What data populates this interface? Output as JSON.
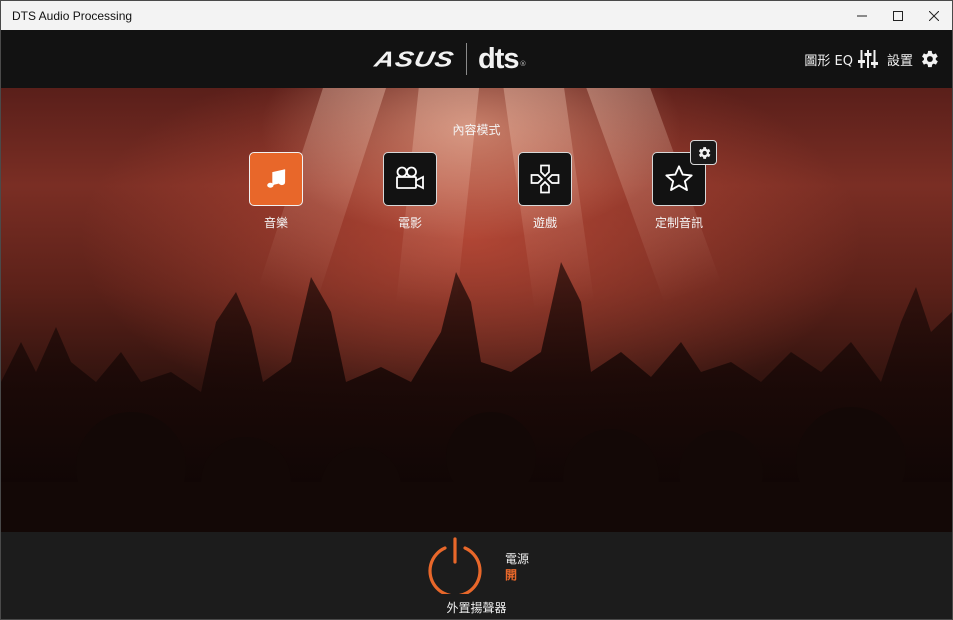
{
  "window": {
    "title": "DTS Audio Processing",
    "controls": [
      "minimize-icon",
      "maximize-icon",
      "close-icon"
    ]
  },
  "header": {
    "brand_logo": "ASUS",
    "audio_logo": "dts",
    "graphic_eq_label": "圖形 EQ",
    "graphic_eq_icon": "equalizer-sliders-icon",
    "settings_label": "設置",
    "settings_icon": "gear-icon"
  },
  "content_mode": {
    "title": "內容模式",
    "modes": [
      {
        "label": "音樂",
        "icon": "music-note-icon",
        "active": true
      },
      {
        "label": "電影",
        "icon": "movie-camera-icon",
        "active": false
      },
      {
        "label": "遊戲",
        "icon": "gamepad-icon",
        "active": false
      },
      {
        "label": "定制音訊",
        "icon": "star-icon",
        "active": false,
        "badge_icon": "gear-icon"
      }
    ]
  },
  "power": {
    "label": "電源",
    "state": "開",
    "device": "外置揚聲器",
    "icon": "power-icon"
  },
  "colors": {
    "accent": "#e8672a",
    "header_bg": "#121212",
    "bottom_bg": "#1c1c1c"
  }
}
